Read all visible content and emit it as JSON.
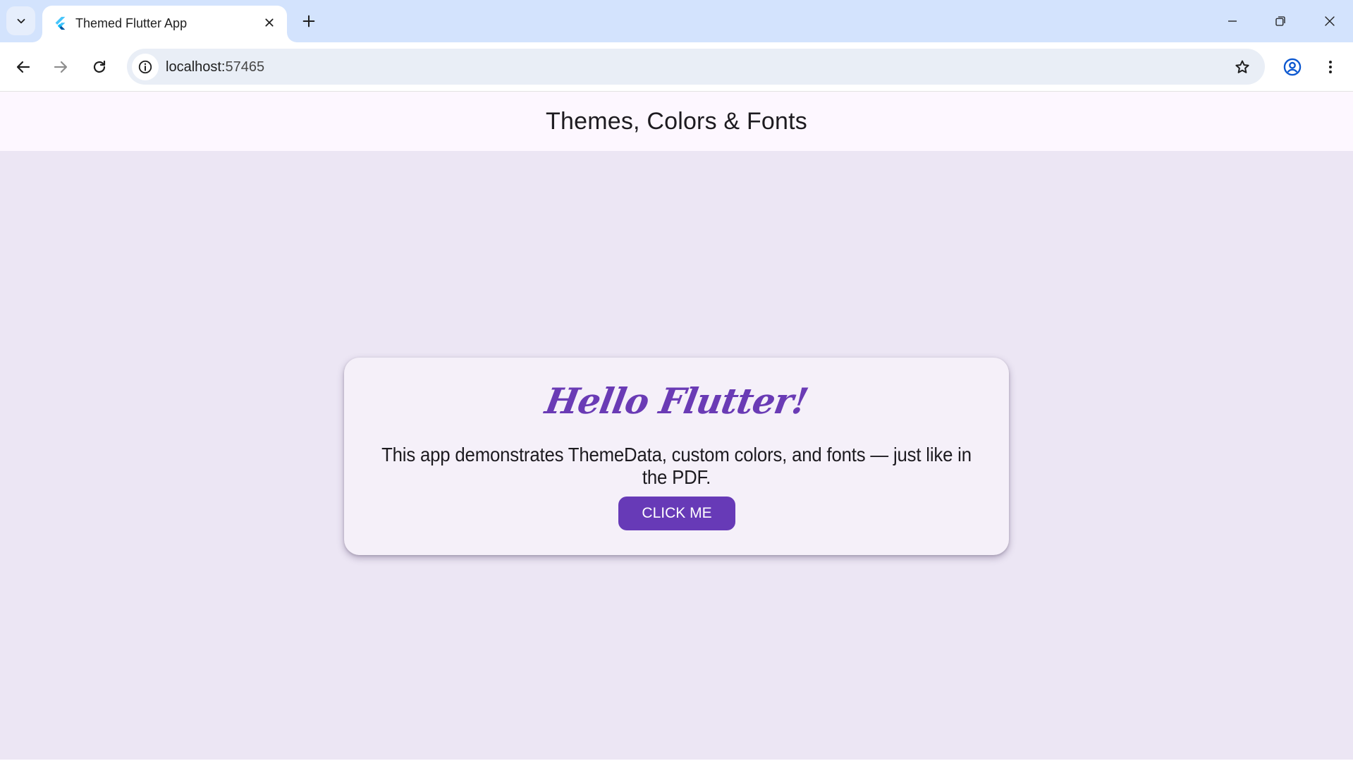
{
  "browser": {
    "tab": {
      "title": "Themed Flutter App",
      "favicon": "flutter-logo-icon"
    },
    "address_bar": {
      "host": "localhost:",
      "port": "57465"
    },
    "icons": {
      "tab_search": "chevron-down-icon",
      "close_tab": "close-icon",
      "new_tab": "plus-icon",
      "minimize": "minimize-icon",
      "restore": "restore-icon",
      "close_window": "close-icon",
      "back": "arrow-left-icon",
      "forward": "arrow-right-icon",
      "reload": "reload-icon",
      "site_info": "info-icon",
      "bookmark": "star-icon",
      "profile": "account-circle-icon",
      "menu": "more-vert-icon"
    }
  },
  "app": {
    "appbar_title": "Themes, Colors & Fonts",
    "card": {
      "heading": "Hello Flutter!",
      "description": "This app demonstrates ThemeData, custom colors, and fonts — just like in the PDF.",
      "button_label": "CLICK ME"
    },
    "colors": {
      "primary": "#673ab7",
      "heading": "#6a3bb5",
      "background": "#ece6f4",
      "appbar": "#fdf7ff",
      "card": "#f5f0f9"
    }
  }
}
